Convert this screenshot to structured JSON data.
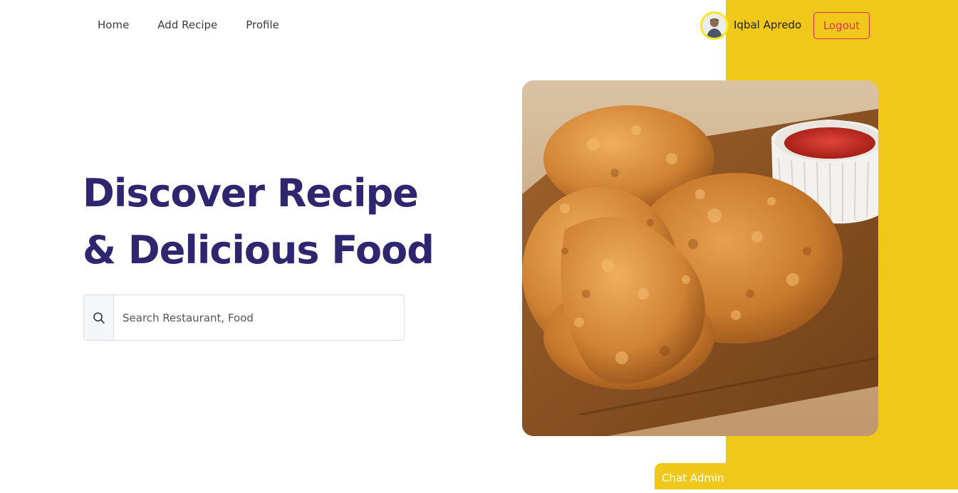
{
  "nav": {
    "items": [
      {
        "label": "Home"
      },
      {
        "label": "Add Recipe"
      },
      {
        "label": "Profile"
      }
    ]
  },
  "user": {
    "name": "Iqbal Apredo",
    "logout_label": "Logout"
  },
  "hero": {
    "title_line1": "Discover Recipe",
    "title_line2": "& Delicious Food"
  },
  "search": {
    "placeholder": "Search Restaurant, Food",
    "value": ""
  },
  "chat": {
    "label": "Chat Admin"
  },
  "colors": {
    "accent_yellow": "#EFC81A",
    "title_navy": "#2E266F",
    "logout_red": "#E0334F"
  },
  "icons": {
    "search": "search-icon",
    "avatar": "avatar",
    "food": "fried-chicken-image"
  }
}
